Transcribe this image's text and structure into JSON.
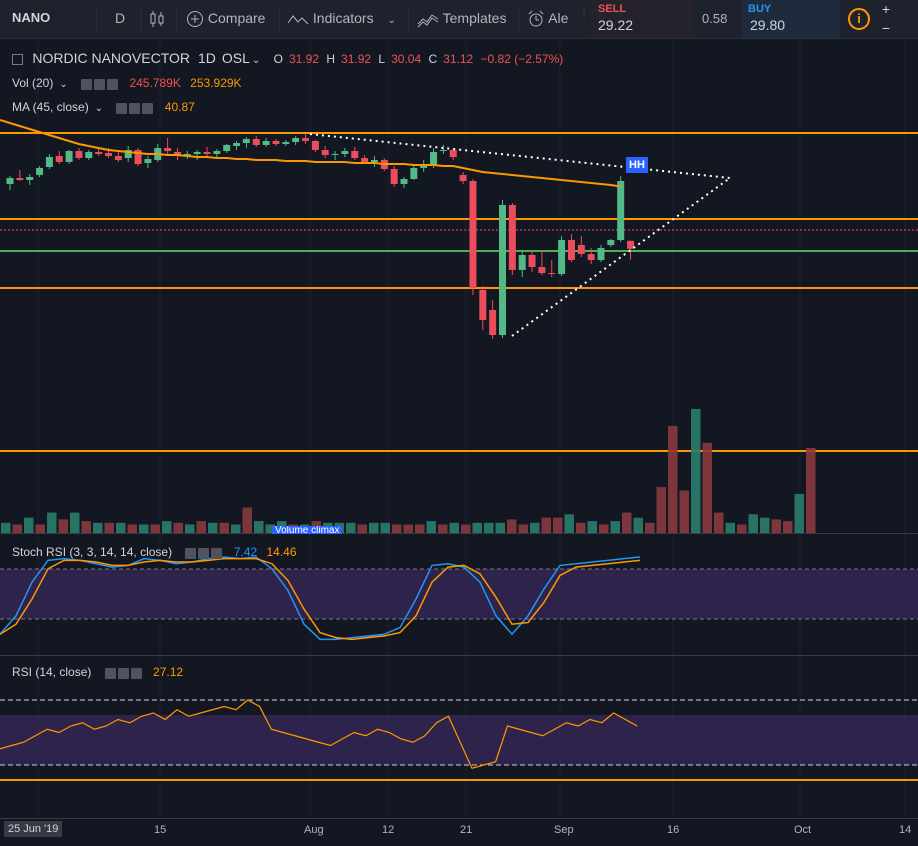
{
  "toolbar": {
    "symbol": "NANO",
    "interval": "D",
    "compare": "Compare",
    "indicators": "Indicators",
    "templates": "Templates",
    "alert": "Ale"
  },
  "trade": {
    "sell_label": "SELL",
    "sell_price": "29.22",
    "spread": "0.58",
    "buy_label": "BUY",
    "buy_price": "29.80"
  },
  "legend": {
    "main": {
      "title": "NORDIC NANOVECTOR",
      "interval": "1D",
      "exchange": "OSL",
      "o_label": "O",
      "o": "31.92",
      "h_label": "H",
      "h": "31.92",
      "l_label": "L",
      "l": "30.04",
      "c_label": "C",
      "c": "31.12",
      "change": "−0.82 (−2.57%)"
    },
    "vol": {
      "label": "Vol (20)",
      "v1": "245.789K",
      "v2": "253.929K"
    },
    "ma": {
      "label": "MA (45, close)",
      "value": "40.87"
    },
    "stoch": {
      "label": "Stoch RSI (3, 3, 14, 14, close)",
      "k": "7.42",
      "d": "14.46"
    },
    "rsi": {
      "label": "RSI (14, close)",
      "value": "27.12"
    }
  },
  "annotations": {
    "hh": "HH",
    "volume_climax": "Volume climax"
  },
  "time_axis": {
    "badge": "25 Jun '19",
    "labels": [
      "15",
      "Aug",
      "12",
      "21",
      "Sep",
      "16",
      "Oct",
      "14"
    ]
  },
  "colors": {
    "background": "#131722",
    "up": "#53b987",
    "down": "#eb4d5c",
    "ma": "#ff9800",
    "horizontal_line": "#ff9800",
    "green_line": "#4caf50",
    "stoch_k": "#2196f3",
    "stoch_d": "#ff9800",
    "rsi_band": "#7e57c2"
  },
  "icons": [
    "candles-icon",
    "plus-circle-icon",
    "indicators-icon",
    "templates-icon",
    "alarm-icon",
    "info-icon"
  ],
  "chart_data": {
    "type": "candlestick",
    "symbol": "NORDIC NANOVECTOR",
    "interval": "1D",
    "exchange": "OSL",
    "x_labels": [
      "25 Jun '19",
      "15",
      "Aug",
      "12",
      "21",
      "Sep",
      "16",
      "Oct",
      "14"
    ],
    "candles": [
      {
        "o": 37.6,
        "h": 38.4,
        "l": 37.0,
        "c": 38.2
      },
      {
        "o": 38.2,
        "h": 39.0,
        "l": 37.9,
        "c": 38.0
      },
      {
        "o": 38.0,
        "h": 38.6,
        "l": 37.5,
        "c": 38.3
      },
      {
        "o": 38.5,
        "h": 39.4,
        "l": 38.3,
        "c": 39.2
      },
      {
        "o": 39.3,
        "h": 40.6,
        "l": 39.1,
        "c": 40.3
      },
      {
        "o": 40.4,
        "h": 40.9,
        "l": 39.6,
        "c": 39.8
      },
      {
        "o": 39.8,
        "h": 41.0,
        "l": 39.6,
        "c": 40.9
      },
      {
        "o": 40.9,
        "h": 41.2,
        "l": 40.0,
        "c": 40.2
      },
      {
        "o": 40.2,
        "h": 41.0,
        "l": 40.0,
        "c": 40.8
      },
      {
        "o": 40.8,
        "h": 41.3,
        "l": 40.4,
        "c": 40.6
      },
      {
        "o": 40.7,
        "h": 41.2,
        "l": 40.2,
        "c": 40.4
      },
      {
        "o": 40.4,
        "h": 40.8,
        "l": 39.8,
        "c": 40.0
      },
      {
        "o": 40.2,
        "h": 41.4,
        "l": 39.8,
        "c": 41.0
      },
      {
        "o": 41.0,
        "h": 41.2,
        "l": 39.4,
        "c": 39.6
      },
      {
        "o": 39.7,
        "h": 40.4,
        "l": 39.2,
        "c": 40.1
      },
      {
        "o": 40.0,
        "h": 41.6,
        "l": 39.8,
        "c": 41.2
      },
      {
        "o": 41.2,
        "h": 42.2,
        "l": 40.6,
        "c": 40.9
      },
      {
        "o": 40.8,
        "h": 41.2,
        "l": 40.0,
        "c": 40.4
      },
      {
        "o": 40.4,
        "h": 40.9,
        "l": 40.1,
        "c": 40.6
      },
      {
        "o": 40.6,
        "h": 41.0,
        "l": 40.0,
        "c": 40.8
      },
      {
        "o": 40.8,
        "h": 41.3,
        "l": 40.4,
        "c": 40.6
      },
      {
        "o": 40.6,
        "h": 41.1,
        "l": 40.2,
        "c": 40.9
      },
      {
        "o": 40.9,
        "h": 41.6,
        "l": 40.7,
        "c": 41.5
      },
      {
        "o": 41.4,
        "h": 41.9,
        "l": 41.0,
        "c": 41.7
      },
      {
        "o": 41.7,
        "h": 42.3,
        "l": 41.2,
        "c": 42.1
      },
      {
        "o": 42.1,
        "h": 42.4,
        "l": 41.3,
        "c": 41.5
      },
      {
        "o": 41.5,
        "h": 42.2,
        "l": 41.3,
        "c": 41.9
      },
      {
        "o": 41.9,
        "h": 42.1,
        "l": 41.4,
        "c": 41.6
      },
      {
        "o": 41.6,
        "h": 42.0,
        "l": 41.4,
        "c": 41.8
      },
      {
        "o": 41.8,
        "h": 42.4,
        "l": 41.5,
        "c": 42.2
      },
      {
        "o": 42.2,
        "h": 42.6,
        "l": 41.6,
        "c": 41.9
      },
      {
        "o": 41.9,
        "h": 42.0,
        "l": 40.8,
        "c": 41.0
      },
      {
        "o": 41.0,
        "h": 41.4,
        "l": 40.2,
        "c": 40.5
      },
      {
        "o": 40.5,
        "h": 40.9,
        "l": 40.0,
        "c": 40.6
      },
      {
        "o": 40.6,
        "h": 41.2,
        "l": 40.3,
        "c": 40.9
      },
      {
        "o": 40.9,
        "h": 41.3,
        "l": 40.0,
        "c": 40.2
      },
      {
        "o": 40.2,
        "h": 40.5,
        "l": 39.6,
        "c": 39.8
      },
      {
        "o": 39.8,
        "h": 40.4,
        "l": 39.3,
        "c": 40.0
      },
      {
        "o": 40.0,
        "h": 40.2,
        "l": 38.9,
        "c": 39.1
      },
      {
        "o": 39.1,
        "h": 39.4,
        "l": 37.3,
        "c": 37.6
      },
      {
        "o": 37.6,
        "h": 38.3,
        "l": 37.2,
        "c": 38.1
      },
      {
        "o": 38.1,
        "h": 39.4,
        "l": 38.0,
        "c": 39.2
      },
      {
        "o": 39.2,
        "h": 40.0,
        "l": 38.8,
        "c": 39.4
      },
      {
        "o": 39.4,
        "h": 41.2,
        "l": 39.2,
        "c": 40.8
      },
      {
        "o": 41.0,
        "h": 41.5,
        "l": 40.6,
        "c": 41.0
      },
      {
        "o": 41.0,
        "h": 41.2,
        "l": 40.0,
        "c": 40.3
      },
      {
        "o": 38.5,
        "h": 38.8,
        "l": 37.6,
        "c": 37.9
      },
      {
        "o": 37.9,
        "h": 38.1,
        "l": 26.5,
        "c": 27.2
      },
      {
        "o": 27.0,
        "h": 27.4,
        "l": 23.0,
        "c": 24.0
      },
      {
        "o": 25.0,
        "h": 26.0,
        "l": 22.1,
        "c": 22.5
      },
      {
        "o": 22.5,
        "h": 36.0,
        "l": 22.2,
        "c": 35.5
      },
      {
        "o": 35.5,
        "h": 35.7,
        "l": 28.5,
        "c": 29.0
      },
      {
        "o": 29.0,
        "h": 31.0,
        "l": 28.3,
        "c": 30.5
      },
      {
        "o": 30.5,
        "h": 31.0,
        "l": 28.8,
        "c": 29.3
      },
      {
        "o": 29.3,
        "h": 31.0,
        "l": 28.5,
        "c": 28.7
      },
      {
        "o": 28.7,
        "h": 30.0,
        "l": 28.3,
        "c": 28.6
      },
      {
        "o": 28.6,
        "h": 32.4,
        "l": 28.4,
        "c": 32.0
      },
      {
        "o": 32.0,
        "h": 32.6,
        "l": 29.8,
        "c": 30.0
      },
      {
        "o": 31.5,
        "h": 32.4,
        "l": 30.3,
        "c": 30.6
      },
      {
        "o": 30.6,
        "h": 31.2,
        "l": 29.6,
        "c": 30.0
      },
      {
        "o": 30.0,
        "h": 31.5,
        "l": 29.8,
        "c": 31.2
      },
      {
        "o": 31.5,
        "h": 32.1,
        "l": 31.3,
        "c": 32.0
      },
      {
        "o": 32.0,
        "h": 38.4,
        "l": 31.8,
        "c": 37.9
      },
      {
        "o": 31.92,
        "h": 31.92,
        "l": 30.04,
        "c": 31.12
      }
    ],
    "ma45": [
      44.0,
      43.7,
      43.4,
      43.1,
      42.8,
      42.5,
      42.2,
      41.9,
      41.6,
      41.4,
      41.2,
      41.0,
      40.9,
      40.8,
      40.7,
      40.6,
      40.6,
      40.5,
      40.5,
      40.4,
      40.3,
      40.3,
      40.2,
      40.2,
      40.1,
      40.1,
      40.0,
      40.0,
      40.0,
      39.9,
      39.9,
      39.9,
      39.8,
      39.8,
      39.8,
      39.8,
      39.7,
      39.7,
      39.7,
      39.6,
      39.6,
      39.6,
      39.5,
      39.5,
      39.5,
      39.4,
      39.4,
      39.2,
      39.0,
      38.8,
      38.7,
      38.6,
      38.5,
      38.4,
      38.3,
      38.2,
      38.1,
      38.0,
      37.9,
      37.8,
      37.7,
      37.6,
      37.5,
      37.35
    ],
    "horizontal_levels": [
      42.7,
      34.1,
      27.2
    ],
    "green_level": 30.9,
    "current_price_line": 33.0,
    "volume": [
      12,
      10,
      18,
      10,
      24,
      16,
      24,
      14,
      12,
      12,
      12,
      10,
      10,
      10,
      14,
      12,
      10,
      14,
      12,
      12,
      10,
      30,
      14,
      10,
      14,
      10,
      10,
      14,
      12,
      12,
      12,
      10,
      12,
      12,
      10,
      10,
      10,
      14,
      10,
      12,
      10,
      12,
      12,
      12,
      16,
      10,
      12,
      18,
      18,
      22,
      12,
      14,
      10,
      14,
      24,
      18,
      12,
      54,
      126,
      50,
      146,
      106,
      24,
      12,
      10,
      22,
      18,
      16,
      14,
      46,
      100
    ],
    "volume_up": [
      true,
      false,
      true,
      false,
      true,
      false,
      true,
      false,
      true,
      false,
      true,
      false,
      true,
      false,
      true,
      false,
      true,
      false,
      true,
      false,
      true,
      false,
      true,
      true,
      true,
      false,
      true,
      false,
      true,
      true,
      true,
      false,
      true,
      true,
      false,
      false,
      false,
      true,
      false,
      true,
      false,
      true,
      true,
      true,
      false,
      false,
      true,
      false,
      false,
      true,
      false,
      true,
      false,
      true,
      false,
      true,
      false,
      false,
      false,
      false,
      true,
      false,
      false,
      true,
      false,
      true,
      true,
      false,
      false,
      true,
      false
    ],
    "stoch_k": [
      8,
      30,
      70,
      96,
      98,
      96,
      92,
      88,
      90,
      98,
      96,
      92,
      94,
      98,
      100,
      98,
      100,
      86,
      60,
      20,
      2,
      2,
      4,
      6,
      8,
      16,
      50,
      90,
      92,
      88,
      70,
      30,
      8,
      30,
      62,
      90,
      92,
      94,
      96,
      98,
      100
    ],
    "stoch_d": [
      8,
      20,
      50,
      86,
      96,
      96,
      94,
      90,
      90,
      94,
      96,
      94,
      94,
      96,
      98,
      98,
      98,
      92,
      72,
      38,
      10,
      4,
      2,
      4,
      6,
      10,
      30,
      70,
      88,
      90,
      80,
      52,
      20,
      22,
      46,
      78,
      88,
      90,
      92,
      94,
      96
    ],
    "rsi": [
      40,
      42,
      44,
      48,
      52,
      50,
      54,
      56,
      52,
      54,
      58,
      56,
      60,
      62,
      58,
      64,
      60,
      62,
      64,
      66,
      64,
      70,
      66,
      52,
      50,
      48,
      46,
      44,
      42,
      46,
      50,
      48,
      52,
      50,
      46,
      44,
      48,
      56,
      60,
      44,
      28,
      30,
      32,
      54,
      52,
      50,
      48,
      52,
      56,
      54,
      58,
      56,
      62,
      58,
      54
    ],
    "stoch_levels": [
      80,
      20
    ],
    "rsi_levels": [
      70,
      30
    ]
  }
}
